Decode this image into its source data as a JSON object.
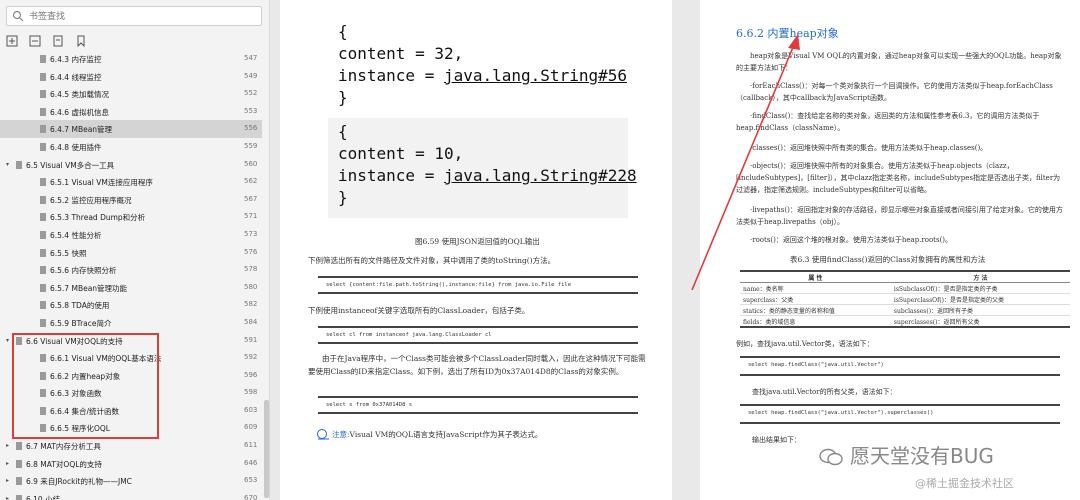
{
  "sidebar": {
    "search_placeholder": "书签查找",
    "items": [
      {
        "label": "6.4.3 内存监控",
        "page": "547",
        "level": 2
      },
      {
        "label": "6.4.4 线程监控",
        "page": "549",
        "level": 2
      },
      {
        "label": "6.4.5 类加载情况",
        "page": "552",
        "level": 2
      },
      {
        "label": "6.4.6 虚拟机信息",
        "page": "553",
        "level": 2
      },
      {
        "label": "6.4.7 MBean管理",
        "page": "556",
        "level": 2,
        "selected": true
      },
      {
        "label": "6.4.8 使用插件",
        "page": "559",
        "level": 2
      },
      {
        "label": "6.5 Visual VM多合一工具",
        "page": "560",
        "level": 1,
        "expanded": true
      },
      {
        "label": "6.5.1 Visual VM连接应用程序",
        "page": "562",
        "level": 2
      },
      {
        "label": "6.5.2 监控应用程序概况",
        "page": "567",
        "level": 2
      },
      {
        "label": "6.5.3 Thread Dump和分析",
        "page": "571",
        "level": 2
      },
      {
        "label": "6.5.4 性能分析",
        "page": "573",
        "level": 2
      },
      {
        "label": "6.5.5 快照",
        "page": "576",
        "level": 2
      },
      {
        "label": "6.5.6 内存快照分析",
        "page": "578",
        "level": 2
      },
      {
        "label": "6.5.7 MBean管理功能",
        "page": "580",
        "level": 2
      },
      {
        "label": "6.5.8 TDA的使用",
        "page": "582",
        "level": 2
      },
      {
        "label": "6.5.9 BTrace简介",
        "page": "584",
        "level": 2
      },
      {
        "label": "6.6 Visual VM对OQL的支持",
        "page": "591",
        "level": 1,
        "expanded": true
      },
      {
        "label": "6.6.1 Visual VM的OQL基本语法",
        "page": "592",
        "level": 2
      },
      {
        "label": "6.6.2 内置heap对象",
        "page": "596",
        "level": 2
      },
      {
        "label": "6.6.3 对象函数",
        "page": "598",
        "level": 2
      },
      {
        "label": "6.6.4 集合/统计函数",
        "page": "603",
        "level": 2
      },
      {
        "label": "6.6.5 程序化OQL",
        "page": "609",
        "level": 2
      },
      {
        "label": "6.7 MAT内存分析工具",
        "page": "611",
        "level": 1
      },
      {
        "label": "6.8 MAT对OQL的支持",
        "page": "646",
        "level": 1
      },
      {
        "label": "6.9 来自JRockit的礼物——JMC",
        "page": "653",
        "level": 1
      },
      {
        "label": "6.10 小结",
        "page": "670",
        "level": 1
      }
    ]
  },
  "left_page": {
    "code_block1": [
      "{",
      "content = 32,",
      "instance = ",
      "java.lang.String#56",
      "}"
    ],
    "code_block2": [
      "{",
      "content = 10,",
      "instance = ",
      "java.lang.String#228",
      "}"
    ],
    "figure_caption": "图6.59   使用JSON返回值的OQL输出",
    "p1": "下例筛选出所有的文件路径及文件对象，其中调用了类的toString()方法。",
    "code1": "select {content:file.path.toString(),instance:file} from java.io.File file",
    "p2": "下例使用instanceof关键字选取所有的ClassLoader，包括子类。",
    "code2": "select cl from instanceof java.lang.ClassLoader cl",
    "p3": "由于在Java程序中，一个Class类可能会被多个ClassLoader同时载入，因此在这种情况下可能需要使用Class的ID来指定Class。如下例，选出了所有ID为0x37A014D8的Class的对象实例。",
    "code3": "select s from 0x37A014D8 s",
    "note_label": "注意:",
    "note": "Visual VM的OQL语言支持JavaScript作为其子表达式。"
  },
  "right_page": {
    "section_title": "6.6.2   内置heap对象",
    "intro": "heap对象是Visual VM OQL的内置对象，通过heap对象可以实现一些强大的OQL功能。heap对象的主要方法如下：",
    "items": [
      "·forEachClass()：对每一个类对象执行一个回调操作。它的使用方法类似于heap.forEachClass（callback），其中callback为JavaScript函数。",
      "·findClass()：查找给定名称的类对象，返回类的方法和属性参考表6.3，它的调用方法类似于heap.findClass（className）。",
      "·classes()：返回堆快照中所有类的集合。使用方法类似于heap.classes()。",
      "·objects()：返回堆快照中所有的对象集合。使用方法类似于heap.objects（clazz，[includeSubtypes]，[filter]），其中clazz指定类名称，includeSubtypes指定是否选出子类，filter为过滤器，指定筛选规则。includeSubtypes和filter可以省略。",
      "·livepaths()：返回指定对象的存活路径，即显示哪些对象直接或者间接引用了给定对象。它的使用方法类似于heap.livepaths（obj）。",
      "·roots()：返回这个堆的根对象。使用方法类似于heap.roots()。"
    ],
    "table_caption": "表6.3   使用findClass()返回的Class对象拥有的属性和方法",
    "table_headers": [
      "属  性",
      "方  法"
    ],
    "table_rows": [
      [
        "name：类名称",
        "isSubclassOf()：是否是指定类的子类"
      ],
      [
        "superclass：父类",
        "isSuperclassOf()：是否是指定类的父类"
      ],
      [
        "statics：类的静态变量的名称和值",
        "subclasses()：返回所有子类"
      ],
      [
        "fields：类的域信息",
        "superclasses()：返回所有父类"
      ]
    ],
    "ex1": "例如，查找java.util.Vector类，语法如下：",
    "code1": "select heap.findClass(\"java.util.Vector\")",
    "ex2": "查找java.util.Vector的所有父类，语法如下：",
    "code2": "select heap.findClass(\"java.util.Vector\").superclasses()",
    "ex3": "输出结果如下："
  },
  "watermark": {
    "main": "愿天堂没有BUG",
    "sub": "@稀土掘金技术社区"
  },
  "colors": {
    "section_title": "#1e6bd6",
    "highlight_box": "#e03c3c",
    "arrow": "#e03c3c"
  }
}
